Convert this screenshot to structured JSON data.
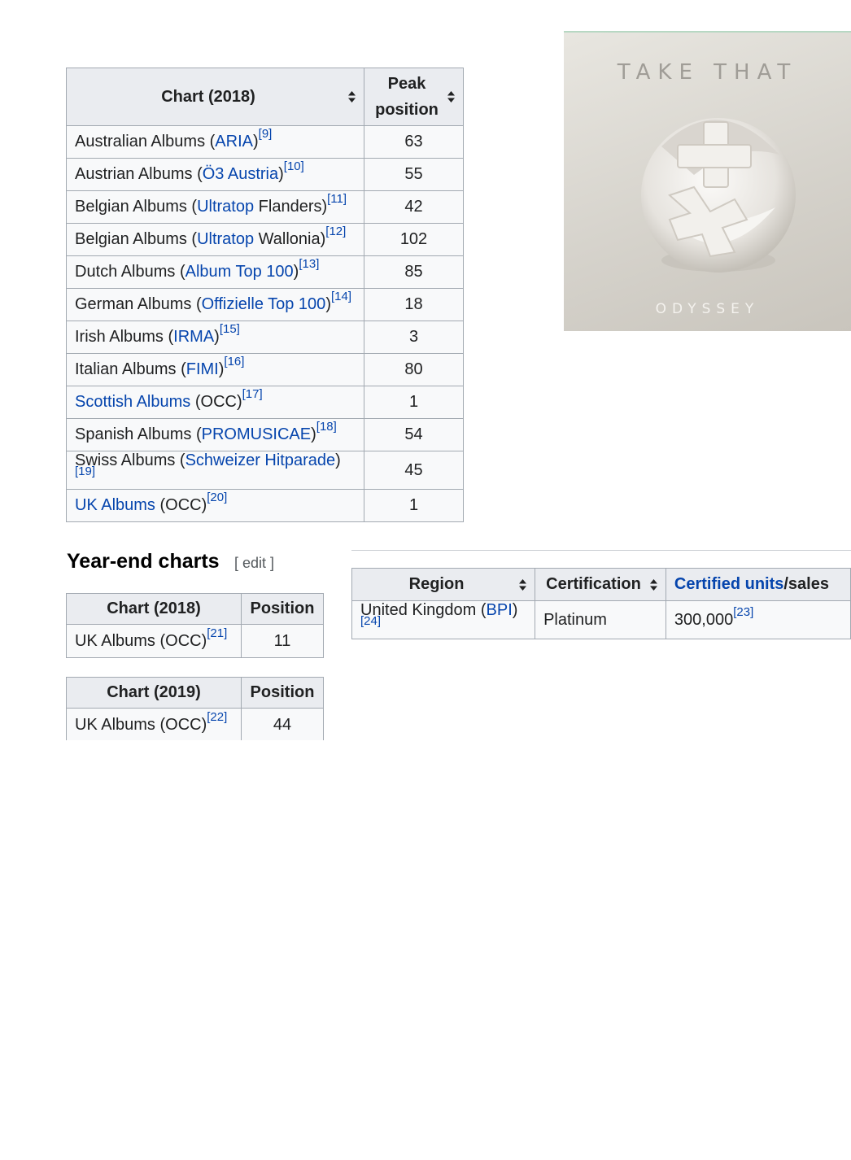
{
  "peak_table": {
    "header_chart": "Chart (2018)",
    "header_peak": "Peak position",
    "rows": [
      {
        "pre": "Australian Albums (",
        "link": "ARIA",
        "post": ")",
        "ref": "[9]",
        "value": "63"
      },
      {
        "pre": "Austrian Albums (",
        "link": "Ö3 Austria",
        "post": ")",
        "ref": "[10]",
        "value": "55"
      },
      {
        "pre": "Belgian Albums (",
        "link": "Ultratop",
        "post": " Flanders)",
        "ref": "[11]",
        "value": "42"
      },
      {
        "pre": "Belgian Albums (",
        "link": "Ultratop",
        "post": " Wallonia)",
        "ref": "[12]",
        "value": "102"
      },
      {
        "pre": "Dutch Albums (",
        "link": "Album Top 100",
        "post": ")",
        "ref": "[13]",
        "value": "85"
      },
      {
        "pre": "German Albums (",
        "link": "Offizielle Top 100",
        "post": ")",
        "ref": "[14]",
        "value": "18"
      },
      {
        "pre": "Irish Albums (",
        "link": "IRMA",
        "post": ")",
        "ref": "[15]",
        "value": "3"
      },
      {
        "pre": "Italian Albums (",
        "link": "FIMI",
        "post": ")",
        "ref": "[16]",
        "value": "80"
      },
      {
        "pre": "",
        "link": "Scottish Albums",
        "post": " (OCC)",
        "ref": "[17]",
        "value": "1"
      },
      {
        "pre": "Spanish Albums (",
        "link": "PROMUSICAE",
        "post": ")",
        "ref": "[18]",
        "value": "54"
      },
      {
        "pre": "Swiss Albums (",
        "link": "Schweizer Hitparade",
        "post": ")",
        "ref": "[19]",
        "value": "45"
      },
      {
        "pre": "",
        "link": "UK Albums",
        "post": " (OCC)",
        "ref": "[20]",
        "value": "1"
      }
    ]
  },
  "album_cover": {
    "artist": "TAKE THAT",
    "title": "ODYSSEY"
  },
  "year_end": {
    "heading": "Year-end charts",
    "edit_label": "[ edit ]",
    "tables": [
      {
        "header_chart": "Chart (2018)",
        "header_position": "Position",
        "row_label": "UK Albums (OCC)",
        "ref": "[21]",
        "value": "11"
      },
      {
        "header_chart": "Chart (2019)",
        "header_position": "Position",
        "row_label": "UK Albums (OCC)",
        "ref": "[22]",
        "value": "44"
      }
    ]
  },
  "certifications": {
    "header_region": "Region",
    "header_certification": "Certification",
    "header_units_link": "Certified units",
    "header_units_rest": "/sales",
    "row": {
      "region_pre": "United Kingdom (",
      "region_link": "BPI",
      "region_post": ")",
      "region_ref": "[24]",
      "certification": "Platinum",
      "units": "300,000",
      "units_ref": "[23]"
    }
  },
  "colors": {
    "link": "#0645ad",
    "header_bg": "#eaecf0",
    "cell_bg": "#f8f9fa",
    "border": "#a2a9b1"
  }
}
